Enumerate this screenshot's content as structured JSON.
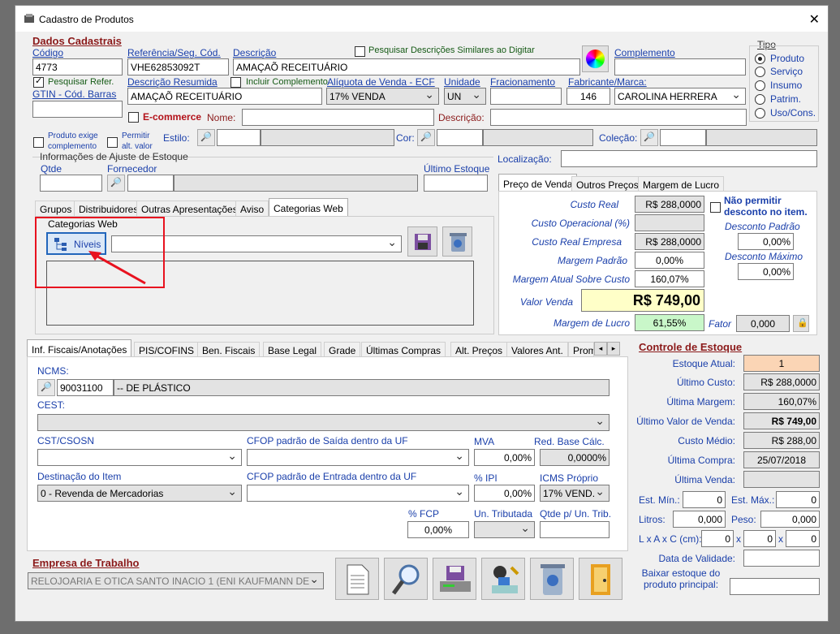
{
  "window": {
    "title": "Cadastro de Produtos",
    "close_icon": "close-icon"
  },
  "dados": {
    "section_title": "Dados Cadastrais",
    "codigo_label": "Código",
    "codigo_value": "4773",
    "referencia_label": "Referência/Seg. Cód.",
    "referencia_value": "VHE62853092T",
    "descricao_label": "Descrição",
    "descricao_value": "AMAÇAÕ RECEITUÁRIO",
    "pesquisar_similares_label": "Pesquisar Descrições Similares ao Digitar",
    "complemento_label": "Complemento",
    "complemento_value": "",
    "pesquisar_refer_label": "Pesquisar Refer.",
    "gtin_label": "GTIN - Cód. Barras",
    "gtin_value": "",
    "descricao_resumida_label": "Descrição Resumida",
    "descricao_resumida_value": "AMAÇAÕ RECEITUÁRIO",
    "incluir_complemento_label": "Incluir Complemento",
    "aliquota_label": "Alíquota de Venda - ECF",
    "aliquota_value": "17% VENDA",
    "unidade_label": "Unidade",
    "unidade_value": "UN",
    "fracionamento_label": "Fracionamento",
    "fracionamento_value": "",
    "fabricante_label": "Fabricante/Marca:",
    "fabricante_code": "146",
    "fabricante_name": "CAROLINA HERRERA",
    "ecommerce_label": "E-commerce",
    "nome_label": "Nome:",
    "descricao2_label": "Descrição:",
    "produto_exige_label": "Produto exige complemento",
    "permitir_alt_label": "Permitir alt. valor",
    "estilo_label": "Estilo:",
    "cor_label": "Cor:",
    "colecao_label": "Coleção:"
  },
  "tipo": {
    "title": "Tipo",
    "options": [
      "Produto",
      "Serviço",
      "Insumo",
      "Patrim.",
      "Uso/Cons."
    ],
    "selected": "Produto"
  },
  "ajuste": {
    "title": "Informações de Ajuste de Estoque",
    "qtde_label": "Qtde",
    "fornecedor_label": "Fornecedor",
    "ultimo_estoque_label": "Último Estoque"
  },
  "localizacao_label": "Localização:",
  "left_tabs": [
    "Grupos",
    "Distribuidores",
    "Outras Apresentações",
    "Aviso",
    "Categorias Web"
  ],
  "categorias": {
    "title": "Categorias Web",
    "niveis_label": "Níveis"
  },
  "price_tabs": [
    "Preço de Venda",
    "Outros Preços",
    "Margem de Lucro"
  ],
  "preco": {
    "custo_real_label": "Custo Real",
    "custo_real": "R$ 288,0000",
    "custo_operacional_label": "Custo Operacional (%)",
    "custo_operacional": "",
    "custo_real_empresa_label": "Custo Real Empresa",
    "custo_real_empresa": "R$ 288,0000",
    "margem_padrao_label": "Margem Padrão",
    "margem_padrao": "0,00%",
    "margem_atual_label": "Margem Atual Sobre Custo",
    "margem_atual": "160,07%",
    "valor_venda_label": "Valor Venda",
    "valor_venda": "R$ 749,00",
    "margem_lucro_label": "Margem de Lucro",
    "margem_lucro": "61,55%",
    "fator_label": "Fator",
    "fator": "0,000",
    "nao_permitir_label": "Não permitir desconto no item.",
    "desconto_padrao_label": "Desconto Padrão",
    "desconto_padrao": "0,00%",
    "desconto_maximo_label": "Desconto Máximo",
    "desconto_maximo": "0,00%"
  },
  "fiscal_tabs": [
    "Inf. Fiscais/Anotações",
    "PIS/COFINS",
    "Ben. Fiscais",
    "Base Legal",
    "Grade",
    "Últimas Compras",
    "Alt. Preços",
    "Valores Ant.",
    "Prom"
  ],
  "fiscal": {
    "ncms_label": "NCMS:",
    "ncm_code": "90031100",
    "ncm_desc": "-- DE PLÁSTICO",
    "cest_label": "CEST:",
    "cst_label": "CST/CSOSN",
    "cfop_saida_label": "CFOP padrão de Saída dentro da UF",
    "mva_label": "MVA",
    "mva": "0,00%",
    "red_base_label": "Red. Base Cálc.",
    "red_base": "0,0000%",
    "destinacao_label": "Destinação do Item",
    "destinacao": "0 - Revenda de Mercadorias",
    "cfop_entrada_label": "CFOP padrão de Entrada dentro da UF",
    "ipi_label": "% IPI",
    "ipi": "0,00%",
    "icms_label": "ICMS Próprio",
    "icms": "17% VEND.",
    "fcp_label": "% FCP",
    "fcp": "0,00%",
    "un_trib_label": "Un. Tributada",
    "qtde_trib_label": "Qtde p/ Un. Trib."
  },
  "estoque": {
    "title": "Controle de Estoque",
    "estoque_atual_label": "Estoque Atual:",
    "estoque_atual": "1",
    "ultimo_custo_label": "Último Custo:",
    "ultimo_custo": "R$ 288,0000",
    "ultima_margem_label": "Última Margem:",
    "ultima_margem": "160,07%",
    "ultimo_valor_label": "Último Valor de Venda:",
    "ultimo_valor": "R$ 749,00",
    "custo_medio_label": "Custo Médio:",
    "custo_medio": "R$ 288,00",
    "ultima_compra_label": "Última Compra:",
    "ultima_compra": "25/07/2018",
    "ultima_venda_label": "Última Venda:",
    "est_min_label": "Est. Mín.:",
    "est_min": "0",
    "est_max_label": "Est. Máx.:",
    "est_max": "0",
    "litros_label": "Litros:",
    "litros": "0,000",
    "peso_label": "Peso:",
    "peso": "0,000",
    "lxaxc_label": "L x A x C (cm):",
    "l": "0",
    "a": "0",
    "c": "0",
    "x_sep": "x",
    "validade_label": "Data de Validade:",
    "baixar_label": "Baixar estoque do produto principal:"
  },
  "empresa": {
    "title": "Empresa de Trabalho",
    "value": "RELOJOARIA E OTICA SANTO INACIO 1  (ENI KAUFMANN DE"
  },
  "colors": {
    "accent": "#8b1a1a",
    "label_blue": "#1a3faa",
    "highlight_red": "#e8121f"
  }
}
